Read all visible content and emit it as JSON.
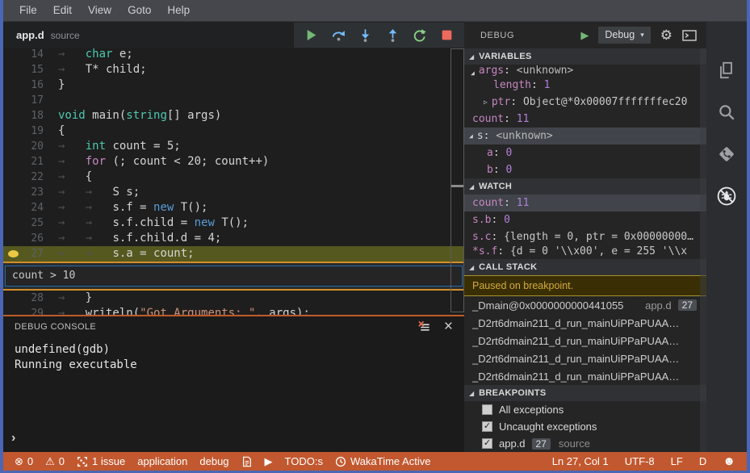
{
  "colors": {
    "window_border": "#4a66b5",
    "status_bar": "#c2582f",
    "current_line": "#56591f",
    "condition_border": "#d28e27",
    "breakpoint_dot": "#eac844",
    "paused_bg": "#3a2f04",
    "panel_bg": "#252526",
    "editor_bg": "#1e1e1e",
    "keyword_teal": "#4ec9b0",
    "keyword_magenta": "#c586c0",
    "keyword_blue": "#569cd6",
    "string_orange": "#ce9178"
  },
  "menu": {
    "items": [
      "File",
      "Edit",
      "View",
      "Goto",
      "Help"
    ]
  },
  "tab": {
    "title": "app.d",
    "description": "source"
  },
  "toolbar": {
    "buttons": [
      {
        "name": "continue-button",
        "icon": "play"
      },
      {
        "name": "step-over-button",
        "icon": "step-over"
      },
      {
        "name": "step-into-button",
        "icon": "step-into"
      },
      {
        "name": "step-out-button",
        "icon": "step-out"
      },
      {
        "name": "restart-button",
        "icon": "restart"
      },
      {
        "name": "stop-button",
        "icon": "stop"
      }
    ]
  },
  "editor": {
    "condition": "count > 10",
    "lines": [
      {
        "num": 14,
        "tokens": [
          [
            "ws",
            "→   "
          ],
          [
            "kw",
            "char"
          ],
          [
            "pl",
            " e;"
          ]
        ]
      },
      {
        "num": 15,
        "tokens": [
          [
            "ws",
            "→   "
          ],
          [
            "pl",
            "T* child;"
          ]
        ]
      },
      {
        "num": 16,
        "tokens": [
          [
            "pl",
            "}"
          ]
        ]
      },
      {
        "num": 17,
        "tokens": []
      },
      {
        "num": 18,
        "tokens": [
          [
            "kw",
            "void"
          ],
          [
            "pl",
            " main("
          ],
          [
            "kw",
            "string"
          ],
          [
            "pl",
            "[] args)"
          ]
        ]
      },
      {
        "num": 19,
        "tokens": [
          [
            "pl",
            "{"
          ]
        ]
      },
      {
        "num": 20,
        "tokens": [
          [
            "ws",
            "→   "
          ],
          [
            "kw",
            "int"
          ],
          [
            "pl",
            " count = 5;"
          ]
        ]
      },
      {
        "num": 21,
        "tokens": [
          [
            "ws",
            "→   "
          ],
          [
            "ctl",
            "for"
          ],
          [
            "pl",
            " (; count < 20; count++)"
          ]
        ]
      },
      {
        "num": 22,
        "tokens": [
          [
            "ws",
            "→   "
          ],
          [
            "pl",
            "{"
          ]
        ]
      },
      {
        "num": 23,
        "tokens": [
          [
            "ws",
            "→   "
          ],
          [
            "ws",
            "→   "
          ],
          [
            "pl",
            "S s;"
          ]
        ]
      },
      {
        "num": 24,
        "tokens": [
          [
            "ws",
            "→   "
          ],
          [
            "ws",
            "→   "
          ],
          [
            "pl",
            "s.f = "
          ],
          [
            "new",
            "new"
          ],
          [
            "pl",
            " T();"
          ]
        ]
      },
      {
        "num": 25,
        "tokens": [
          [
            "ws",
            "→   "
          ],
          [
            "ws",
            "→   "
          ],
          [
            "pl",
            "s.f.child = "
          ],
          [
            "new",
            "new"
          ],
          [
            "pl",
            " T();"
          ]
        ]
      },
      {
        "num": 26,
        "tokens": [
          [
            "ws",
            "→   "
          ],
          [
            "ws",
            "→   "
          ],
          [
            "pl",
            "s.f.child.d = 4;"
          ]
        ]
      },
      {
        "num": 27,
        "bp": true,
        "current": true,
        "condition_after": true,
        "tokens": [
          [
            "ws",
            "→   "
          ],
          [
            "ws",
            "→   "
          ],
          [
            "pl",
            "s.a = count;"
          ]
        ]
      },
      {
        "num": 28,
        "tokens": [
          [
            "ws",
            "→   "
          ],
          [
            "pl",
            "}"
          ]
        ]
      },
      {
        "num": 29,
        "tokens": [
          [
            "ws",
            "→   "
          ],
          [
            "pl",
            "writeln("
          ],
          [
            "str",
            "\"Got Arguments: \""
          ],
          [
            "pl",
            ", args);"
          ]
        ]
      }
    ]
  },
  "console": {
    "title": "DEBUG CONSOLE",
    "lines": [
      "undefined(gdb)",
      "Running executable"
    ],
    "prompt": "›"
  },
  "panel": {
    "header": {
      "title": "DEBUG",
      "config": "Debug",
      "caret": "▾"
    },
    "variables": {
      "title": "VARIABLES",
      "rows": [
        {
          "pad": 8,
          "arrow": "expanded",
          "name": "args",
          "value": "<unknown>",
          "vcls": "unk",
          "clip": "top"
        },
        {
          "pad": 36,
          "name": "length",
          "value": "1",
          "vcls": "num"
        },
        {
          "pad": 24,
          "arrow": "collapsed",
          "name": "ptr",
          "value": "Object@*0x00007fffffffec20",
          "vcls": "str"
        },
        {
          "pad": 10,
          "name": "count",
          "value": "11",
          "vcls": "num"
        },
        {
          "pad": 6,
          "arrow": "expanded",
          "name": "s",
          "ncls": "plain",
          "value": "<unknown>",
          "vcls": "unk",
          "selected": true
        },
        {
          "pad": 28,
          "name": "a",
          "value": "0",
          "vcls": "num"
        },
        {
          "pad": 28,
          "name": "b",
          "value": "0",
          "vcls": "num"
        }
      ]
    },
    "watch": {
      "title": "WATCH",
      "rows": [
        {
          "pad": 10,
          "name": "count",
          "value": "11",
          "vcls": "num",
          "selected": true
        },
        {
          "pad": 10,
          "name": "s.b",
          "value": "0",
          "vcls": "num"
        },
        {
          "pad": 10,
          "name": "s.c",
          "value": "{length = 0, ptr = 0x00000000…",
          "vcls": "str"
        },
        {
          "pad": 10,
          "name": "*s.f",
          "value": "{d = 0 '\\\\x00', e = 255 '\\\\x",
          "vcls": "str",
          "clip": "bottom"
        }
      ]
    },
    "callstack": {
      "title": "CALL STACK",
      "status": "Paused on breakpoint.",
      "frames": [
        {
          "label": "_Dmain@0x0000000000441055",
          "file": "app.d",
          "badge": "27"
        },
        {
          "label": "_D2rt6dmain211_d_run_mainUiPPaPUAA…"
        },
        {
          "label": "_D2rt6dmain211_d_run_mainUiPPaPUAA…"
        },
        {
          "label": "_D2rt6dmain211_d_run_mainUiPPaPUAA…"
        },
        {
          "label": "_D2rt6dmain211_d_run_mainUiPPaPUAA…"
        }
      ]
    },
    "breakpoints": {
      "title": "BREAKPOINTS",
      "items": [
        {
          "checked": false,
          "label": "All exceptions"
        },
        {
          "checked": true,
          "label": "Uncaught exceptions"
        },
        {
          "checked": true,
          "label": "app.d",
          "badge": "27",
          "desc": "source"
        }
      ]
    }
  },
  "activitybar": {
    "icons": [
      {
        "name": "files-icon",
        "icon": "files"
      },
      {
        "name": "search-icon",
        "icon": "search"
      },
      {
        "name": "source-control-icon",
        "icon": "git"
      },
      {
        "name": "debug-disabled-icon",
        "icon": "bug-off",
        "active": true
      }
    ]
  },
  "statusbar": {
    "left": [
      {
        "icon": "error",
        "text": "0",
        "name": "error-count"
      },
      {
        "icon": "warning",
        "text": "0",
        "name": "warning-count"
      },
      {
        "icon": "issues",
        "text": "1 issue",
        "name": "issues-indicator"
      },
      {
        "text": "application",
        "name": "status-application"
      },
      {
        "text": "debug",
        "name": "status-debug"
      },
      {
        "icon": "doc",
        "name": "report-icon"
      },
      {
        "icon": "play-small",
        "name": "run-icon"
      },
      {
        "text": "TODO:s",
        "name": "status-todos"
      },
      {
        "icon": "clock",
        "text": "WakaTime Active",
        "name": "status-wakatime"
      }
    ],
    "right": [
      {
        "text": "Ln 27, Col 1",
        "name": "cursor-position"
      },
      {
        "text": "UTF-8",
        "name": "encoding"
      },
      {
        "text": "LF",
        "name": "eol"
      },
      {
        "text": "D",
        "name": "language-mode"
      },
      {
        "icon": "smiley",
        "name": "feedback-smiley"
      }
    ]
  }
}
